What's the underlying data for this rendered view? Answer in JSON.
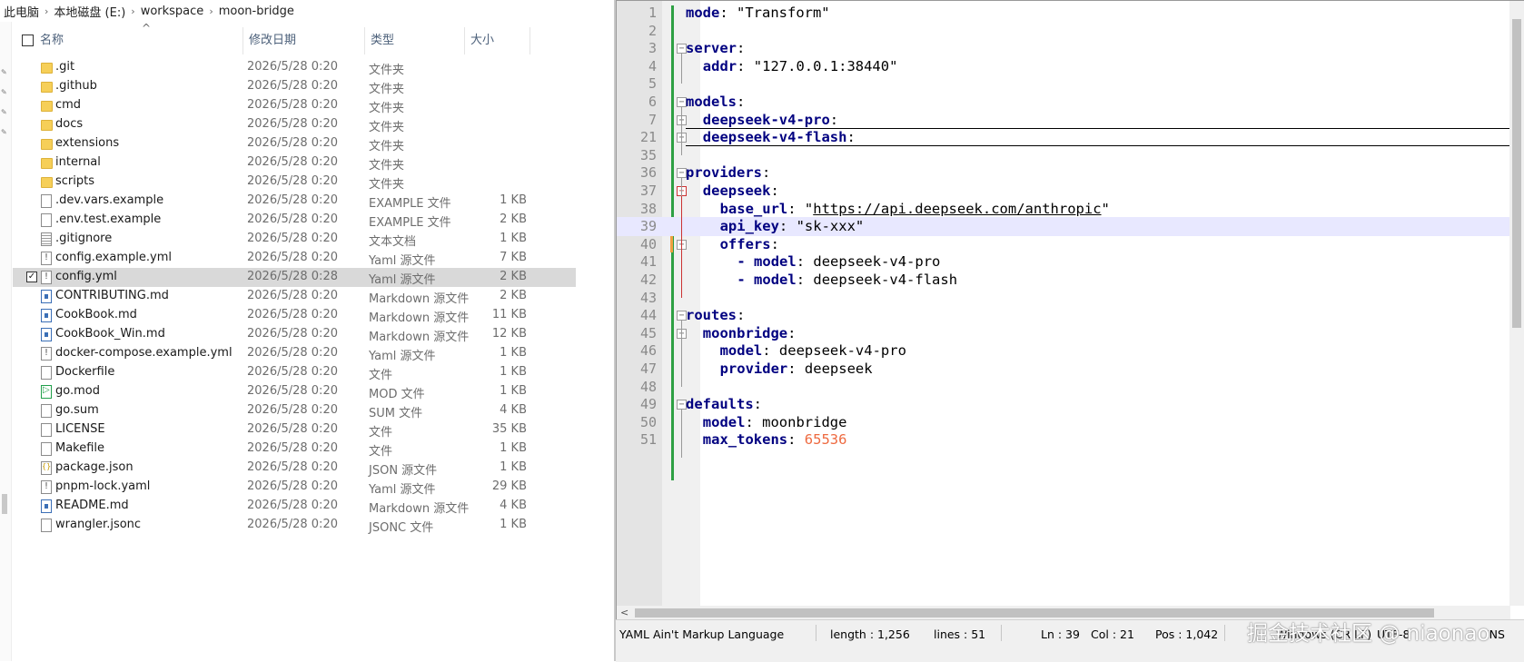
{
  "breadcrumb": [
    "此电脑",
    "本地磁盘 (E:)",
    "workspace",
    "moon-bridge"
  ],
  "explorer": {
    "columns": {
      "name": "名称",
      "date": "修改日期",
      "type": "类型",
      "size": "大小"
    },
    "files": [
      {
        "name": ".git",
        "date": "2026/5/28 0:20",
        "type": "文件夹",
        "size": "",
        "icon": "folder"
      },
      {
        "name": ".github",
        "date": "2026/5/28 0:20",
        "type": "文件夹",
        "size": "",
        "icon": "folder"
      },
      {
        "name": "cmd",
        "date": "2026/5/28 0:20",
        "type": "文件夹",
        "size": "",
        "icon": "folder"
      },
      {
        "name": "docs",
        "date": "2026/5/28 0:20",
        "type": "文件夹",
        "size": "",
        "icon": "folder"
      },
      {
        "name": "extensions",
        "date": "2026/5/28 0:20",
        "type": "文件夹",
        "size": "",
        "icon": "folder"
      },
      {
        "name": "internal",
        "date": "2026/5/28 0:20",
        "type": "文件夹",
        "size": "",
        "icon": "folder"
      },
      {
        "name": "scripts",
        "date": "2026/5/28 0:20",
        "type": "文件夹",
        "size": "",
        "icon": "folder"
      },
      {
        "name": ".dev.vars.example",
        "date": "2026/5/28 0:20",
        "type": "EXAMPLE 文件",
        "size": "1 KB",
        "icon": "file"
      },
      {
        "name": ".env.test.example",
        "date": "2026/5/28 0:20",
        "type": "EXAMPLE 文件",
        "size": "2 KB",
        "icon": "file"
      },
      {
        "name": ".gitignore",
        "date": "2026/5/28 0:20",
        "type": "文本文档",
        "size": "1 KB",
        "icon": "file-text"
      },
      {
        "name": "config.example.yml",
        "date": "2026/5/28 0:20",
        "type": "Yaml 源文件",
        "size": "7 KB",
        "icon": "file-yaml"
      },
      {
        "name": "config.yml",
        "date": "2026/5/28 0:28",
        "type": "Yaml 源文件",
        "size": "2 KB",
        "icon": "file-yaml",
        "selected": true
      },
      {
        "name": "CONTRIBUTING.md",
        "date": "2026/5/28 0:20",
        "type": "Markdown 源文件",
        "size": "2 KB",
        "icon": "file-md"
      },
      {
        "name": "CookBook.md",
        "date": "2026/5/28 0:20",
        "type": "Markdown 源文件",
        "size": "11 KB",
        "icon": "file-md"
      },
      {
        "name": "CookBook_Win.md",
        "date": "2026/5/28 0:20",
        "type": "Markdown 源文件",
        "size": "12 KB",
        "icon": "file-md"
      },
      {
        "name": "docker-compose.example.yml",
        "date": "2026/5/28 0:20",
        "type": "Yaml 源文件",
        "size": "1 KB",
        "icon": "file-yaml"
      },
      {
        "name": "Dockerfile",
        "date": "2026/5/28 0:20",
        "type": "文件",
        "size": "1 KB",
        "icon": "file"
      },
      {
        "name": "go.mod",
        "date": "2026/5/28 0:20",
        "type": "MOD 文件",
        "size": "1 KB",
        "icon": "file-go"
      },
      {
        "name": "go.sum",
        "date": "2026/5/28 0:20",
        "type": "SUM 文件",
        "size": "4 KB",
        "icon": "file"
      },
      {
        "name": "LICENSE",
        "date": "2026/5/28 0:20",
        "type": "文件",
        "size": "35 KB",
        "icon": "file"
      },
      {
        "name": "Makefile",
        "date": "2026/5/28 0:20",
        "type": "文件",
        "size": "1 KB",
        "icon": "file"
      },
      {
        "name": "package.json",
        "date": "2026/5/28 0:20",
        "type": "JSON 源文件",
        "size": "1 KB",
        "icon": "file-json"
      },
      {
        "name": "pnpm-lock.yaml",
        "date": "2026/5/28 0:20",
        "type": "Yaml 源文件",
        "size": "29 KB",
        "icon": "file-yaml"
      },
      {
        "name": "README.md",
        "date": "2026/5/28 0:20",
        "type": "Markdown 源文件",
        "size": "4 KB",
        "icon": "file-md"
      },
      {
        "name": "wrangler.jsonc",
        "date": "2026/5/28 0:20",
        "type": "JSONC 文件",
        "size": "1 KB",
        "icon": "file"
      }
    ]
  },
  "editor": {
    "current_line": "39",
    "lines": [
      {
        "num": "1",
        "indent": 0,
        "tokens": [
          [
            "k",
            "mode"
          ],
          [
            "s",
            ": \"Transform\""
          ]
        ]
      },
      {
        "num": "2",
        "indent": 0,
        "tokens": []
      },
      {
        "num": "3",
        "indent": 0,
        "fold": "minus",
        "tokens": [
          [
            "k",
            "server"
          ],
          [
            "s",
            ":"
          ]
        ]
      },
      {
        "num": "4",
        "indent": 1,
        "tokens": [
          [
            "k",
            "addr"
          ],
          [
            "s",
            ": \"127.0.0.1:38440\""
          ]
        ]
      },
      {
        "num": "5",
        "indent": 0,
        "tokens": []
      },
      {
        "num": "6",
        "indent": 0,
        "fold": "minus",
        "tokens": [
          [
            "k",
            "models"
          ],
          [
            "s",
            ":"
          ]
        ]
      },
      {
        "num": "7",
        "indent": 1,
        "fold": "plus",
        "collapsed": true,
        "tokens": [
          [
            "k",
            "deepseek-v4-pro"
          ],
          [
            "s",
            ":"
          ]
        ]
      },
      {
        "num": "21",
        "indent": 1,
        "fold": "plus",
        "collapsed": true,
        "tokens": [
          [
            "k",
            "deepseek-v4-flash"
          ],
          [
            "s",
            ":"
          ]
        ]
      },
      {
        "num": "35",
        "indent": 0,
        "tokens": []
      },
      {
        "num": "36",
        "indent": 0,
        "fold": "minus",
        "tokens": [
          [
            "k",
            "providers"
          ],
          [
            "s",
            ":"
          ]
        ]
      },
      {
        "num": "37",
        "indent": 1,
        "fold": "minus-red",
        "tokens": [
          [
            "k",
            "deepseek"
          ],
          [
            "s",
            ":"
          ]
        ]
      },
      {
        "num": "38",
        "indent": 2,
        "tokens": [
          [
            "k",
            "base_url"
          ],
          [
            "s",
            ": \""
          ],
          [
            "u",
            "https://api.deepseek.com/anthropic"
          ],
          [
            "s",
            "\""
          ]
        ]
      },
      {
        "num": "39",
        "indent": 2,
        "tokens": [
          [
            "k",
            "api_key"
          ],
          [
            "s",
            ": \"sk-xxx\""
          ]
        ]
      },
      {
        "num": "40",
        "indent": 2,
        "fold": "minus",
        "tokens": [
          [
            "k",
            "offers"
          ],
          [
            "s",
            ":"
          ]
        ]
      },
      {
        "num": "41",
        "indent": 3,
        "tokens": [
          [
            "k",
            "- model"
          ],
          [
            "s",
            ": deepseek-v4-pro"
          ]
        ]
      },
      {
        "num": "42",
        "indent": 3,
        "tokens": [
          [
            "k",
            "- model"
          ],
          [
            "s",
            ": deepseek-v4-flash"
          ]
        ]
      },
      {
        "num": "43",
        "indent": 0,
        "tokens": []
      },
      {
        "num": "44",
        "indent": 0,
        "fold": "minus",
        "tokens": [
          [
            "k",
            "routes"
          ],
          [
            "s",
            ":"
          ]
        ]
      },
      {
        "num": "45",
        "indent": 1,
        "fold": "minus",
        "tokens": [
          [
            "k",
            "moonbridge"
          ],
          [
            "s",
            ":"
          ]
        ]
      },
      {
        "num": "46",
        "indent": 2,
        "tokens": [
          [
            "k",
            "model"
          ],
          [
            "s",
            ": deepseek-v4-pro"
          ]
        ]
      },
      {
        "num": "47",
        "indent": 2,
        "tokens": [
          [
            "k",
            "provider"
          ],
          [
            "s",
            ": deepseek"
          ]
        ]
      },
      {
        "num": "48",
        "indent": 0,
        "tokens": []
      },
      {
        "num": "49",
        "indent": 0,
        "fold": "minus",
        "tokens": [
          [
            "k",
            "defaults"
          ],
          [
            "s",
            ":"
          ]
        ]
      },
      {
        "num": "50",
        "indent": 1,
        "tokens": [
          [
            "k",
            "model"
          ],
          [
            "s",
            ": moonbridge"
          ]
        ]
      },
      {
        "num": "51",
        "indent": 1,
        "tokens": [
          [
            "k",
            "max_tokens"
          ],
          [
            "s",
            ": "
          ],
          [
            "n",
            "65536"
          ]
        ]
      }
    ]
  },
  "statusbar": {
    "language": "YAML Ain't Markup Language",
    "length": "length : 1,256",
    "lines": "lines : 51",
    "ln": "Ln : 39",
    "col": "Col : 21",
    "pos": "Pos : 1,042",
    "eol": "Windows (CR LF)",
    "encoding": "UTF-8",
    "mode": "INS"
  },
  "watermark": "掘金技术社区 @ niaonao",
  "colors": {
    "keyword": "#000080",
    "number": "#ee6a40",
    "change_bar": "#2ea043",
    "current_line": "#e8e8ff",
    "selected_row": "#d9d9d9"
  }
}
